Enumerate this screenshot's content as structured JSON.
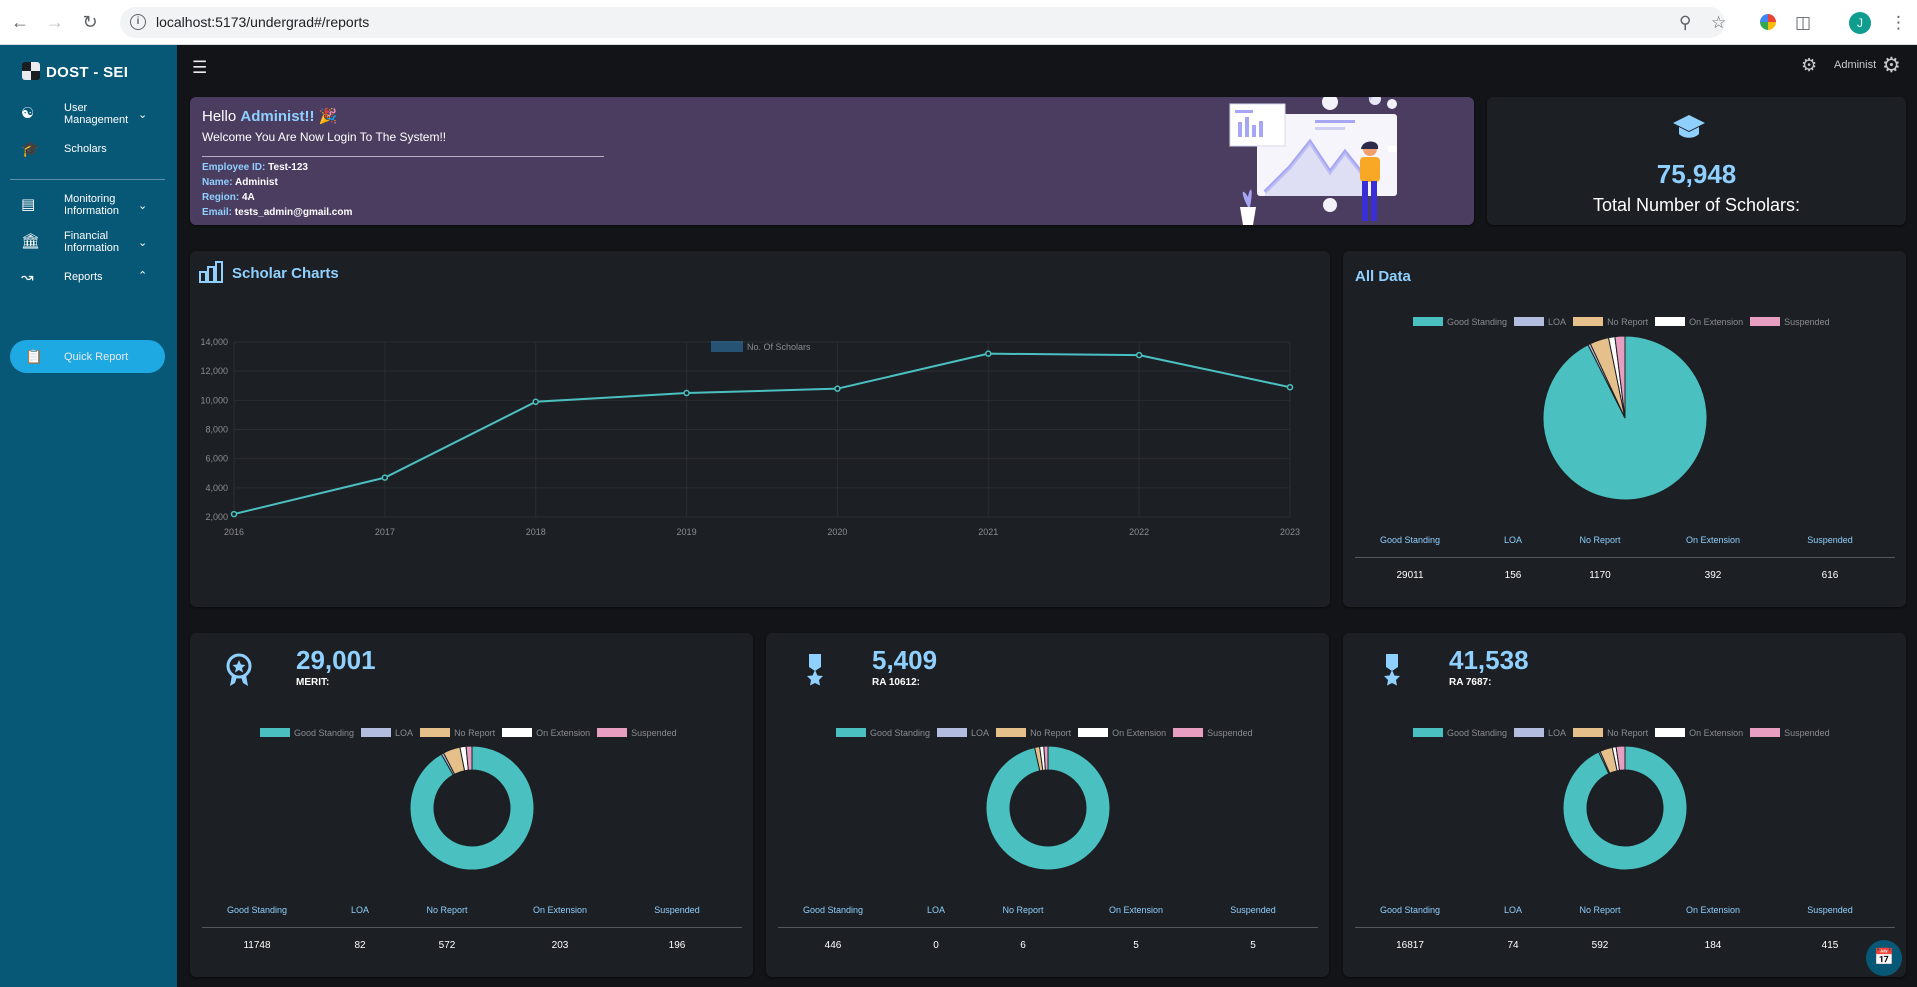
{
  "browser": {
    "url": "localhost:5173/undergrad#/reports",
    "avatar": "J"
  },
  "sidebar": {
    "brand": "DOST - SEI",
    "items": [
      {
        "label": "User Management",
        "icon": "users-icon",
        "chevron": "chevron-down"
      },
      {
        "label": "Scholars",
        "icon": "graduation-cap-icon"
      },
      {
        "label": "Monitoring Information",
        "icon": "monitor-icon",
        "chevron": "chevron-down"
      },
      {
        "label": "Financial Information",
        "icon": "bank-icon",
        "chevron": "chevron-down"
      },
      {
        "label": "Reports",
        "icon": "reports-icon",
        "chevron": "chevron-up"
      }
    ],
    "active": {
      "label": "Quick Report",
      "icon": "quick-report-icon"
    }
  },
  "topbar": {
    "username": "Administ"
  },
  "welcome": {
    "greeting": "Hello",
    "name": "Administ!!",
    "emoji": "🎉",
    "message": "Welcome You Are Now Login To The System!!",
    "fields": [
      {
        "key": "Employee ID:",
        "value": "Test-123"
      },
      {
        "key": "Name:",
        "value": "Administ"
      },
      {
        "key": "Region:",
        "value": "4A"
      },
      {
        "key": "Email:",
        "value": "tests_admin@gmail.com"
      }
    ]
  },
  "total": {
    "value": "75,948",
    "label": "Total Number of Scholars:"
  },
  "status_labels": [
    "Good Standing",
    "LOA",
    "No Report",
    "On Extension",
    "Suspended"
  ],
  "colors": {
    "Good Standing": "#4bc0c0",
    "LOA": "#b3bde0",
    "No Report": "#e5c08a",
    "On Extension": "#ffffff",
    "Suspended": "#e89ec0",
    "accent": "#8fd0ff",
    "sidebar": "#075776",
    "active": "#1ea9e3"
  },
  "line_chart": {
    "title": "Scholar Charts",
    "chart_data": {
      "type": "line",
      "x": [
        "2016",
        "2017",
        "2018",
        "2019",
        "2020",
        "2021",
        "2022",
        "2023"
      ],
      "series": [
        {
          "name": "No. Of Scholars",
          "values": [
            2200,
            4700,
            9900,
            10500,
            10800,
            13200,
            13100,
            10900
          ]
        }
      ],
      "yticks": [
        "2,000",
        "4,000",
        "6,000",
        "8,000",
        "10,000",
        "12,000",
        "14,000"
      ],
      "ylim": [
        2000,
        14000
      ],
      "legend": "top-center",
      "grid": true
    }
  },
  "all_data": {
    "title": "All Data",
    "chart_data": {
      "type": "pie",
      "labels": [
        "Good Standing",
        "LOA",
        "No Report",
        "On Extension",
        "Suspended"
      ],
      "values": [
        29011,
        156,
        1170,
        392,
        616
      ]
    },
    "values": [
      "29011",
      "156",
      "1170",
      "392",
      "616"
    ]
  },
  "breakdown": [
    {
      "value": "29,001",
      "label": "MERIT:",
      "icon": "award-icon",
      "chart_data": {
        "type": "pie",
        "variant": "doughnut",
        "labels": [
          "Good Standing",
          "LOA",
          "No Report",
          "On Extension",
          "Suspended"
        ],
        "values": [
          11748,
          82,
          572,
          203,
          196
        ]
      },
      "values": [
        "11748",
        "82",
        "572",
        "203",
        "196"
      ]
    },
    {
      "value": "5,409",
      "label": "RA 10612:",
      "icon": "medal-icon",
      "chart_data": {
        "type": "pie",
        "variant": "doughnut",
        "labels": [
          "Good Standing",
          "LOA",
          "No Report",
          "On Extension",
          "Suspended"
        ],
        "values": [
          446,
          0,
          6,
          5,
          5
        ]
      },
      "values": [
        "446",
        "0",
        "6",
        "5",
        "5"
      ]
    },
    {
      "value": "41,538",
      "label": "RA 7687:",
      "icon": "medal-icon",
      "chart_data": {
        "type": "pie",
        "variant": "doughnut",
        "labels": [
          "Good Standing",
          "LOA",
          "No Report",
          "On Extension",
          "Suspended"
        ],
        "values": [
          16817,
          74,
          592,
          184,
          415
        ]
      },
      "values": [
        "16817",
        "74",
        "592",
        "184",
        "415"
      ]
    }
  ]
}
